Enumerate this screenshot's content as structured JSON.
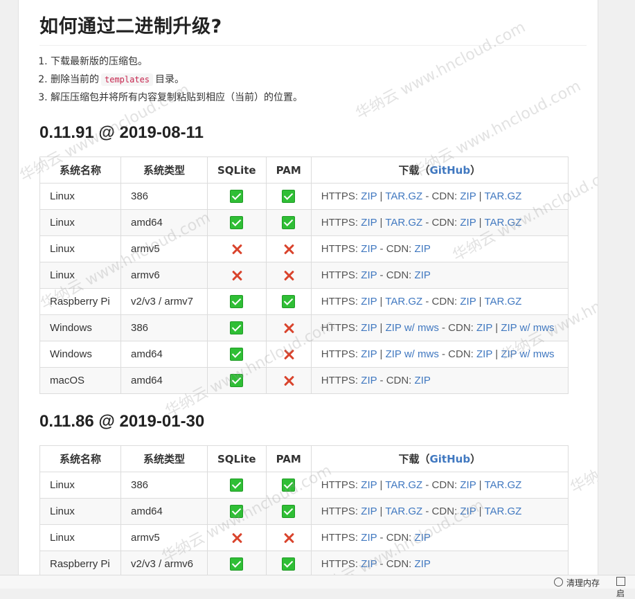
{
  "title": "如何通过二进制升级?",
  "steps": [
    {
      "before": "下载最新版的压缩包。",
      "code": "",
      "after": ""
    },
    {
      "before": "删除当前的",
      "code": "templates",
      "after": "目录。"
    },
    {
      "before": "解压压缩包并将所有内容复制粘贴到相应（当前）的位置。",
      "code": "",
      "after": ""
    }
  ],
  "columns": {
    "name": "系统名称",
    "type": "系统类型",
    "sqlite": "SQLite",
    "pam": "PAM",
    "download": "下载",
    "github": "GitHub"
  },
  "releases": [
    {
      "heading": "0.11.91 @ 2019-08-11",
      "rows": [
        {
          "name": "Linux",
          "type": "386",
          "sqlite": true,
          "pam": true,
          "links": [
            "HTTPS: ",
            "ZIP",
            " | ",
            "TAR.GZ",
            " - CDN: ",
            "ZIP",
            " | ",
            "TAR.GZ"
          ]
        },
        {
          "name": "Linux",
          "type": "amd64",
          "sqlite": true,
          "pam": true,
          "links": [
            "HTTPS: ",
            "ZIP",
            " | ",
            "TAR.GZ",
            " - CDN: ",
            "ZIP",
            " | ",
            "TAR.GZ"
          ]
        },
        {
          "name": "Linux",
          "type": "armv5",
          "sqlite": false,
          "pam": false,
          "links": [
            "HTTPS: ",
            "ZIP",
            " - CDN: ",
            "ZIP"
          ]
        },
        {
          "name": "Linux",
          "type": "armv6",
          "sqlite": false,
          "pam": false,
          "links": [
            "HTTPS: ",
            "ZIP",
            " - CDN: ",
            "ZIP"
          ]
        },
        {
          "name": "Raspberry Pi",
          "type": "v2/v3 / armv7",
          "sqlite": true,
          "pam": true,
          "links": [
            "HTTPS: ",
            "ZIP",
            " | ",
            "TAR.GZ",
            " - CDN: ",
            "ZIP",
            " | ",
            "TAR.GZ"
          ]
        },
        {
          "name": "Windows",
          "type": "386",
          "sqlite": true,
          "pam": false,
          "links": [
            "HTTPS: ",
            "ZIP",
            " | ",
            "ZIP w/ mws",
            " - CDN: ",
            "ZIP",
            " | ",
            "ZIP w/ mws"
          ]
        },
        {
          "name": "Windows",
          "type": "amd64",
          "sqlite": true,
          "pam": false,
          "links": [
            "HTTPS: ",
            "ZIP",
            " | ",
            "ZIP w/ mws",
            " - CDN: ",
            "ZIP",
            " | ",
            "ZIP w/ mws"
          ]
        },
        {
          "name": "macOS",
          "type": "amd64",
          "sqlite": true,
          "pam": false,
          "links": [
            "HTTPS: ",
            "ZIP",
            " - CDN: ",
            "ZIP"
          ]
        }
      ]
    },
    {
      "heading": "0.11.86 @ 2019-01-30",
      "rows": [
        {
          "name": "Linux",
          "type": "386",
          "sqlite": true,
          "pam": true,
          "links": [
            "HTTPS: ",
            "ZIP",
            " | ",
            "TAR.GZ",
            " - CDN: ",
            "ZIP",
            " | ",
            "TAR.GZ"
          ]
        },
        {
          "name": "Linux",
          "type": "amd64",
          "sqlite": true,
          "pam": true,
          "links": [
            "HTTPS: ",
            "ZIP",
            " | ",
            "TAR.GZ",
            " - CDN: ",
            "ZIP",
            " | ",
            "TAR.GZ"
          ]
        },
        {
          "name": "Linux",
          "type": "armv5",
          "sqlite": false,
          "pam": false,
          "links": [
            "HTTPS: ",
            "ZIP",
            " - CDN: ",
            "ZIP"
          ]
        },
        {
          "name": "Raspberry Pi",
          "type": "v2/v3 / armv6",
          "sqlite": true,
          "pam": true,
          "links": [
            "HTTPS: ",
            "ZIP",
            " - CDN: ",
            "ZIP"
          ]
        }
      ]
    }
  ],
  "watermark": "华纳云 www.hncloud.com",
  "statusbar": {
    "memory": "清理内存",
    "extra": "启"
  },
  "colors": {
    "link": "#4078c0",
    "check": "#2fbe35",
    "cross": "#d9442d",
    "code": "#c7254e"
  }
}
